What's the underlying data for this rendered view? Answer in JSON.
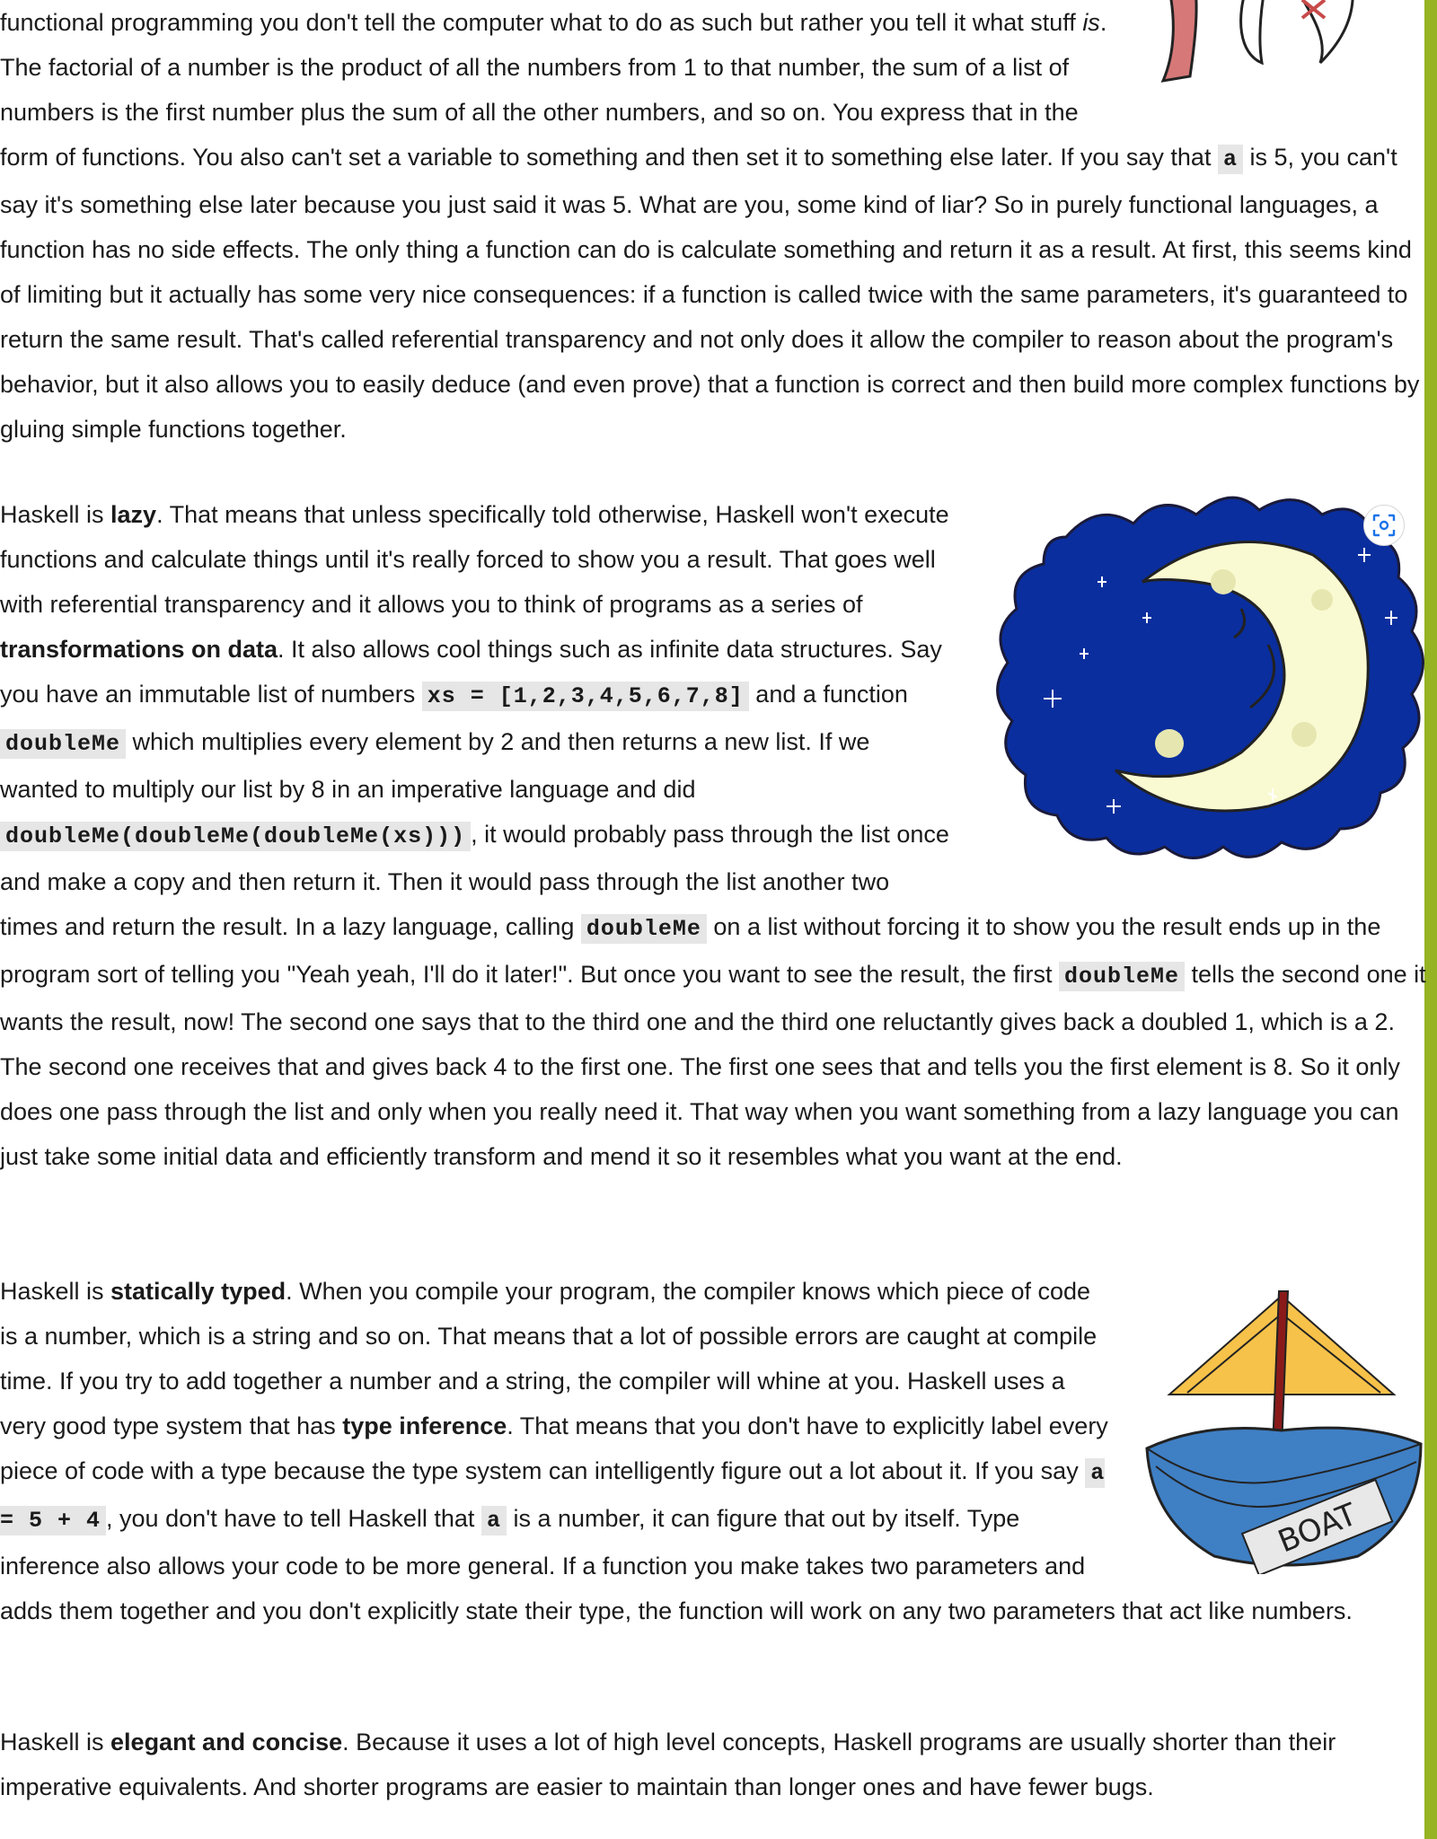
{
  "paragraphs": {
    "p1": {
      "intro": "functional programming you don't tell the computer what to do as such but rather you tell it what stuff ",
      "is_word": "is",
      "t1": ". The factorial of a number is the product of all the numbers from 1 to that number, the sum of a list of numbers is the first number plus the sum of all the other numbers, and so on. You express that in the form of functions. You also can't set a variable to something and then set it to something else later. If you say that ",
      "code_a": "a",
      "t2": " is 5, you can't say it's something else later because you just said it was 5. What are you, some kind of liar? So in purely functional languages, a function has no side effects. The only thing a function can do is calculate something and return it as a result. At first, this seems kind of limiting but it actually has some very nice consequences: if a function is called twice with the same parameters, it's guaranteed to return the same result. That's called referential transparency and not only does it allow the compiler to reason about the program's behavior, but it also allows you to easily deduce (and even prove) that a function is correct and then build more complex functions by gluing simple functions together."
    },
    "p2": {
      "t0": "Haskell is ",
      "bold_lazy": "lazy",
      "t1": ". That means that unless specifically told otherwise, Haskell won't execute functions and calculate things until it's really forced to show you a result. That goes well with referential transparency and it allows you to think of programs as a series of ",
      "bold_transform": "transformations on data",
      "t2": ". It also allows cool things such as infinite data structures. Say you have an immutable list of numbers ",
      "code_xs": "xs = [1,2,3,4,5,6,7,8]",
      "t3": " and a function ",
      "code_doubleme1": "doubleMe",
      "t4": " which multiplies every element by 2 and then returns a new list. If we wanted to multiply our list by 8 in an imperative language and did ",
      "code_nested": "doubleMe(doubleMe(doubleMe(xs)))",
      "t5": ", it would probably pass through the list once and make a copy and then return it. Then it would pass through the list another two times and return the result. In a lazy language, calling ",
      "code_doubleme2": "doubleMe",
      "t6": " on a list without forcing it to show you the result ends up in the program sort of telling you \"Yeah yeah, I'll do it later!\". But once you want to see the result, the first ",
      "code_doubleme3": "doubleMe",
      "t7": " tells the second one it wants the result, now! The second one says that to the third one and the third one reluctantly gives back a doubled 1, which is a 2. The second one receives that and gives back 4 to the first one. The first one sees that and tells you the first element is 8. So it only does one pass through the list and only when you really need it. That way when you want something from a lazy language you can just take some initial data and efficiently transform and mend it so it resembles what you want at the end."
    },
    "p3": {
      "t0": "Haskell is ",
      "bold_static": "statically typed",
      "t1": ". When you compile your program, the compiler knows which piece of code is a number, which is a string and so on. That means that a lot of possible errors are caught at compile time. If you try to add together a number and a string, the compiler will whine at you. Haskell uses a very good type system that has ",
      "bold_infer": "type inference",
      "t2": ". That means that you don't have to explicitly label every piece of code with a type because the type system can intelligently figure out a lot about it. If you say ",
      "code_a54": "a = 5 + 4",
      "t3": ", you don't have to tell Haskell that ",
      "code_a": "a",
      "t4": " is a number, it can figure that out by itself. Type inference also allows your code to be more general. If a function you make takes two parameters and adds them together and you don't explicitly state their type, the function will work on any two parameters that act like numbers."
    },
    "p4": {
      "t0": "Haskell is ",
      "bold_elegant": "elegant and concise",
      "t1": ". Because it uses a lot of high level concepts, Haskell programs are usually shorter than their imperative equivalents. And shorter programs are easier to maintain than longer ones and have fewer bugs."
    }
  },
  "images": {
    "boat_label": "BOAT"
  },
  "colors": {
    "accent_border": "#95b322",
    "code_bg": "#e6e6e6",
    "moon_sky": "#0a2e9e",
    "moon_fill": "#fafad2",
    "boat_sail": "#f7c24a",
    "boat_hull": "#3f7fc4",
    "boat_mast": "#8a1a1a"
  }
}
